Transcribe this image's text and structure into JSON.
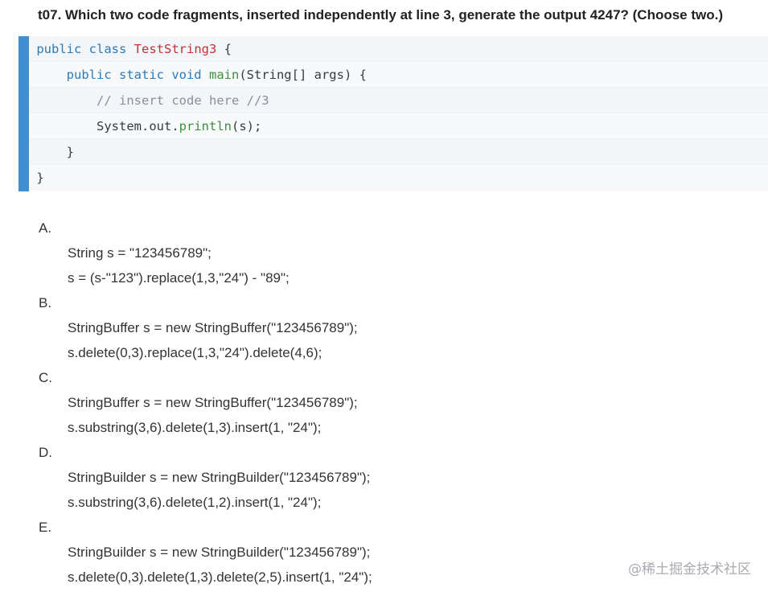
{
  "question": {
    "title": "t07. Which two code fragments, inserted independently at line 3, generate the output 4247? (Choose two.)"
  },
  "code": {
    "line1": {
      "kw": "public class ",
      "cls": "TestString3",
      "rest": " {"
    },
    "line2": {
      "indent": "    ",
      "kw": "public static void ",
      "fn": "main",
      "rest": "(String[] args) {"
    },
    "line3": {
      "indent": "        ",
      "comment": "// insert code here //3"
    },
    "line4": {
      "indent": "        ",
      "pre": "System.out.",
      "fn": "println",
      "rest": "(s);"
    },
    "line5": {
      "indent": "    ",
      "rest": "}"
    },
    "line6": {
      "indent": "",
      "rest": "}"
    }
  },
  "options": [
    {
      "letter": "A.",
      "line1": "String s = \"123456789\";",
      "line2": "s = (s-\"123\").replace(1,3,\"24\") - \"89\";"
    },
    {
      "letter": "B.",
      "line1": "StringBuffer s = new StringBuffer(\"123456789\");",
      "line2": "s.delete(0,3).replace(1,3,\"24\").delete(4,6);"
    },
    {
      "letter": "C.",
      "line1": "StringBuffer s = new StringBuffer(\"123456789\");",
      "line2": "s.substring(3,6).delete(1,3).insert(1, \"24\");"
    },
    {
      "letter": "D.",
      "line1": "StringBuilder s = new StringBuilder(\"123456789\");",
      "line2": "s.substring(3,6).delete(1,2).insert(1, \"24\");"
    },
    {
      "letter": "E.",
      "line1": "StringBuilder s = new StringBuilder(\"123456789\");",
      "line2": "s.delete(0,3).delete(1,3).delete(2,5).insert(1, \"24\");"
    }
  ],
  "watermark": "@稀土掘金技术社区"
}
